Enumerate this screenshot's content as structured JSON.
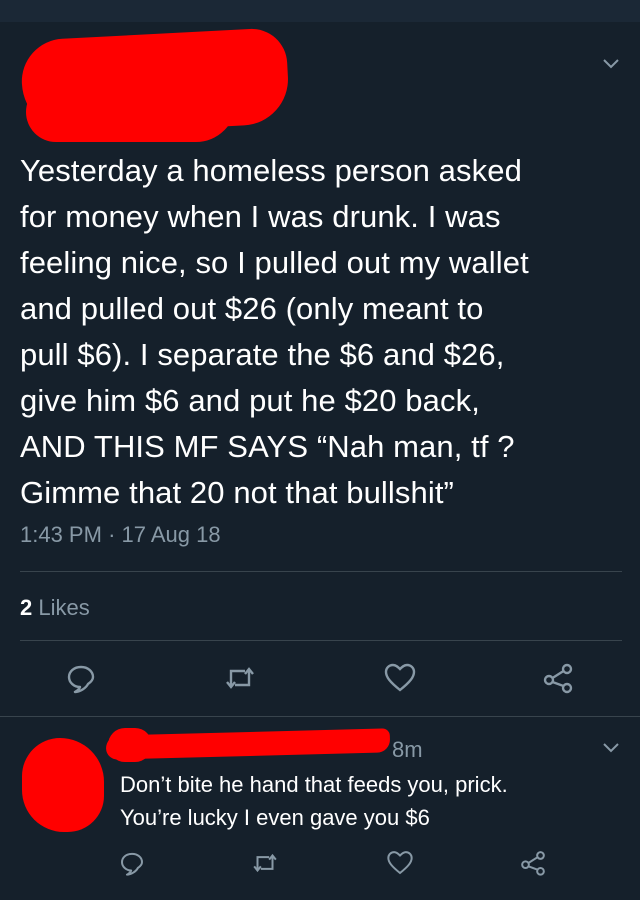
{
  "tweet": {
    "text": "Yesterday a homeless person asked\nfor money when I was drunk. I was\nfeeling nice, so I pulled out my wallet\nand pulled out $26 (only meant to\npull $6).  I separate the $6 and $26,\ngive him $6 and put he $20 back,\nAND THIS MF SAYS “Nah man, tf ?\nGimme that 20 not that bullshit”",
    "time": "1:43 PM",
    "dot": "·",
    "date": "17 Aug 18",
    "likes_count": "2",
    "likes_label": "Likes"
  },
  "reply": {
    "age": "8m",
    "text": "Don’t bite he hand that feeds you, prick.\nYou’re lucky I even gave you $6"
  },
  "colors": {
    "background": "#15202b",
    "redaction": "#ff0000",
    "muted_text": "#8899a6",
    "divider": "#38444d"
  },
  "icons": {
    "reply": "speech-bubble-icon",
    "retweet": "retweet-icon",
    "like": "heart-icon",
    "share": "share-icon",
    "menu": "chevron-down-icon"
  }
}
